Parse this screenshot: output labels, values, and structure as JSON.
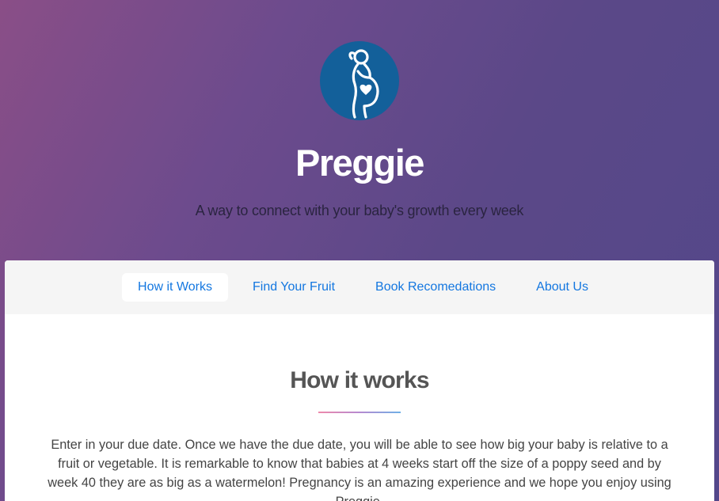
{
  "hero": {
    "logo_icon": "pregnant-woman-heart-icon",
    "title": "Preggie",
    "subtitle": "A way to connect with your baby's growth every week"
  },
  "nav": {
    "items": [
      {
        "label": "How it Works",
        "active": true
      },
      {
        "label": "Find Your Fruit",
        "active": false
      },
      {
        "label": "Book Recomedations",
        "active": false
      },
      {
        "label": "About Us",
        "active": false
      }
    ]
  },
  "main": {
    "section_title": "How it works",
    "body": "Enter in your due date. Once we have the due date, you will be able to see how big your baby is relative to a fruit or vegetable. It is remarkable to know that babies at 4 weeks start off the size of a poppy seed and by week 40 they are as big as a watermelon! Pregnancy is an amazing experience and we hope you enjoy using Preggie."
  },
  "colors": {
    "logo_bg": "#13609a",
    "link": "#1477e0",
    "nav_bg": "#f5f5f5",
    "divider_start": "#ee8aab",
    "divider_end": "#6fb0e6"
  }
}
